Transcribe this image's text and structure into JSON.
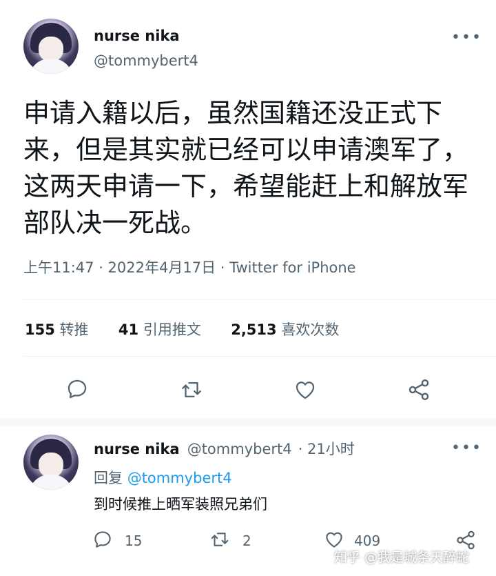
{
  "tweet": {
    "display_name": "nurse nika",
    "handle": "@tommybert4",
    "more_glyph": "•••",
    "text": "申请入籍以后，虽然国籍还没正式下来，但是其实就已经可以申请澳军了，这两天申请一下，希望能赶上和解放军部队决一死战。",
    "timestamp": "上午11:47 · 2022年4月17日 · Twitter for iPhone",
    "stats": {
      "retweets_count": "155",
      "retweets_label": "转推",
      "quotes_count": "41",
      "quotes_label": "引用推文",
      "likes_count": "2,513",
      "likes_label": "喜欢次数"
    },
    "actions": [
      "reply-icon",
      "retweet-icon",
      "like-icon",
      "share-icon"
    ]
  },
  "reply": {
    "display_name": "nurse nika",
    "handle": "@tommybert4",
    "time": "· 21小时",
    "more_glyph": "•••",
    "reply_prefix": "回复",
    "reply_to": "@tommybert4",
    "text": "到时候推上晒军装照兄弟们",
    "counts": {
      "replies": "15",
      "retweets": "2",
      "likes": "409"
    }
  },
  "watermark": "知乎 @我是城条天醉蛇",
  "colors": {
    "link": "#1d9bf0",
    "secondary_text": "#536471",
    "primary_text": "#0f1419"
  }
}
